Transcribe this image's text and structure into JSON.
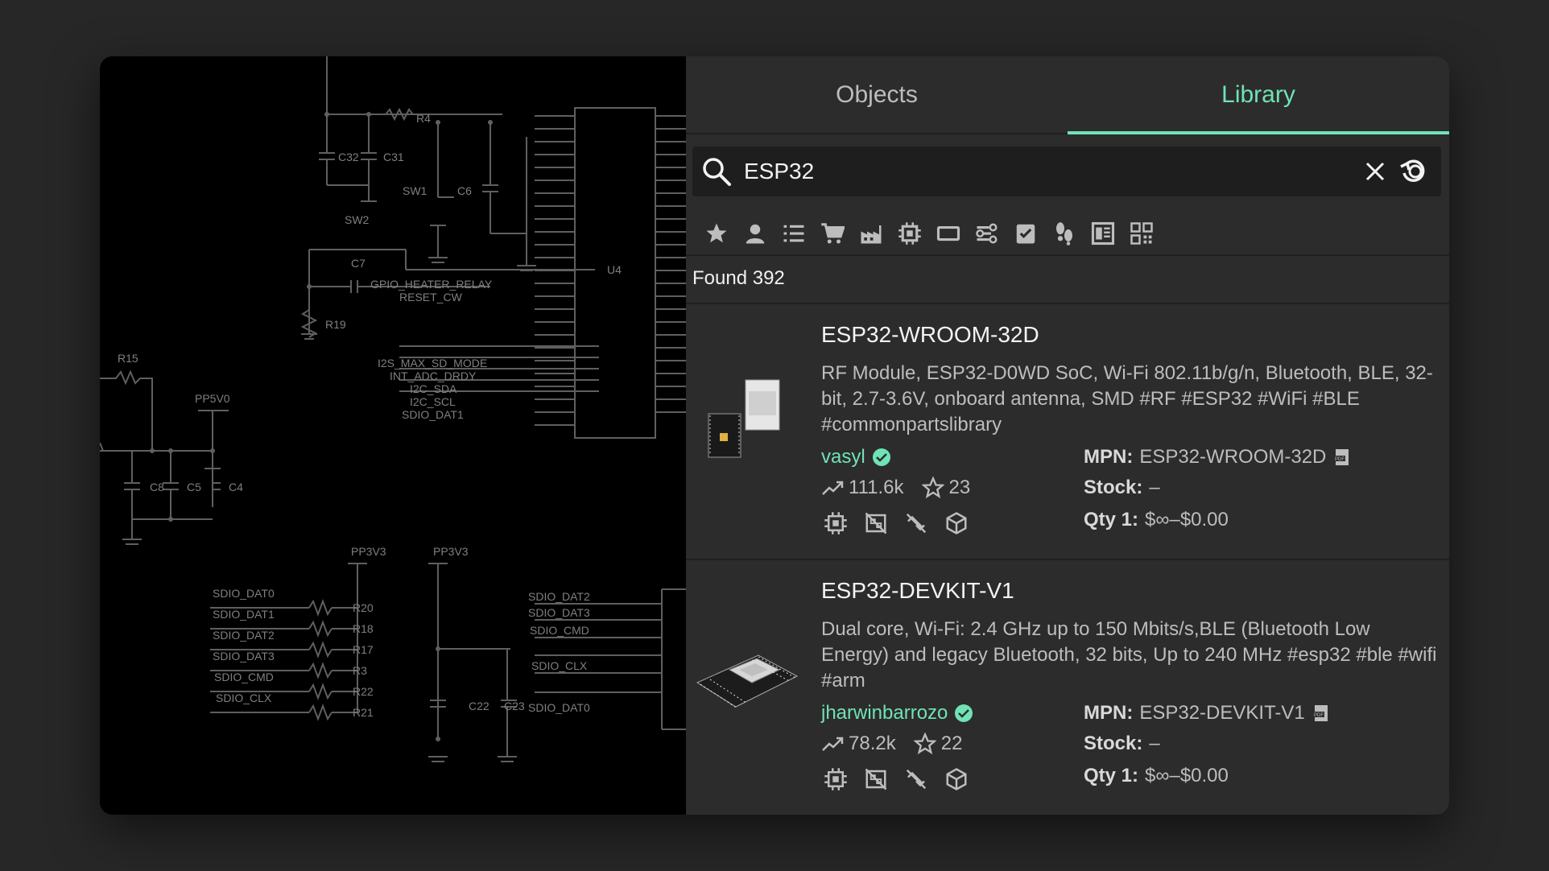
{
  "tabs": [
    {
      "label": "Objects",
      "active": false
    },
    {
      "label": "Library",
      "active": true
    }
  ],
  "search": {
    "value": "ESP32"
  },
  "filters": [
    "star-icon",
    "user-icon",
    "list-icon",
    "cart-icon",
    "factory-icon",
    "chip-icon",
    "board-icon",
    "route-icon",
    "checklist-icon",
    "footprint-icon",
    "layout-icon",
    "qr-icon"
  ],
  "results": {
    "found_label": "Found 392"
  },
  "parts": [
    {
      "name": "ESP32-WROOM-32D",
      "description": "RF Module, ESP32-D0WD SoC, Wi-Fi 802.11b/g/n, Bluetooth, BLE, 32-bit, 2.7-3.6V, onboard antenna, SMD #RF #ESP32 #WiFi #BLE #commonpartslibrary",
      "author": "vasyl",
      "views": "111.6k",
      "stars": "23",
      "mpn_label": "MPN:",
      "mpn": "ESP32-WROOM-32D",
      "stock_label": "Stock:",
      "stock": "–",
      "qty_label": "Qty 1:",
      "qty_price": "$∞–$0.00"
    },
    {
      "name": "ESP32-DEVKIT-V1",
      "description": "Dual core, Wi-Fi: 2.4 GHz up to 150 Mbits/s,BLE (Bluetooth Low Energy) and legacy Bluetooth, 32 bits, Up to 240 MHz #esp32 #ble #wifi #arm",
      "author": "jharwinbarrozo",
      "views": "78.2k",
      "stars": "22",
      "mpn_label": "MPN:",
      "mpn": "ESP32-DEVKIT-V1",
      "stock_label": "Stock:",
      "stock": "–",
      "qty_label": "Qty 1:",
      "qty_price": "$∞–$0.00"
    }
  ],
  "schematic": {
    "labels": [
      "R4",
      "C32",
      "C31",
      "SW1",
      "C6",
      "SW2",
      "C7",
      "GPIO_HEATER_RELAY",
      "RESET_CW",
      "R19",
      "U4",
      "R15",
      "PP5V0",
      "I2S_MAX_SD_MODE",
      "INT_ADC_DRDY",
      "I2C_SDA",
      "I2C_SCL",
      "SDIO_DAT1",
      "C8",
      "C5",
      "C4",
      "PP3V3",
      "PP3V3",
      "SDIO_DAT0",
      "SDIO_DAT1",
      "SDIO_DAT2",
      "SDIO_DAT3",
      "SDIO_CMD",
      "SDIO_CLX",
      "R20",
      "R18",
      "R17",
      "R3",
      "R22",
      "R21",
      "SDIO_DAT2",
      "SDIO_DAT3",
      "SDIO_CMD",
      "SDIO_CLX",
      "C22",
      "C23",
      "SDIO_DAT0"
    ]
  },
  "colors": {
    "accent": "#6fe3b6",
    "panel": "#2c2c2c",
    "background": "#272727"
  }
}
